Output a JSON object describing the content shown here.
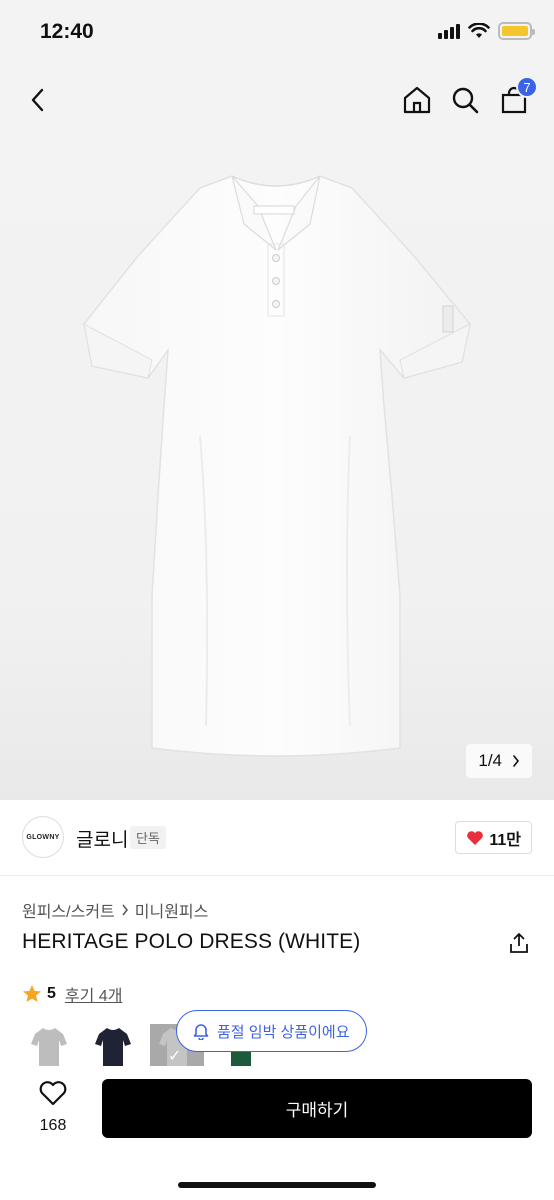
{
  "status": {
    "time": "12:40"
  },
  "nav": {
    "cart_count": "7"
  },
  "gallery": {
    "counter": "1/4",
    "label_text": "GLOWNY"
  },
  "brand": {
    "logo_text": "GLOWNY",
    "name": "글로니",
    "tag": "단독",
    "likes": "11만"
  },
  "breadcrumb": {
    "level1": "원피스/스커트",
    "level2": "미니원피스"
  },
  "product": {
    "title": "HERITAGE POLO DRESS (WHITE)"
  },
  "rating": {
    "score": "5",
    "reviews": "후기 4개"
  },
  "swatches": [
    {
      "name": "grey",
      "color": "#bdbdbd"
    },
    {
      "name": "navy",
      "color": "#1f2333"
    },
    {
      "name": "white",
      "color": "#ffffff",
      "selected": true
    },
    {
      "name": "green",
      "color": "#1d5a3b"
    }
  ],
  "toast": {
    "text": "품절 임박 상품이에요"
  },
  "bottom": {
    "wish_count": "168",
    "buy_label": "구매하기"
  },
  "colors": {
    "accent": "#3b63e6",
    "heart": "#e8303d",
    "star": "#f5a623",
    "buy_button": "#000000"
  }
}
